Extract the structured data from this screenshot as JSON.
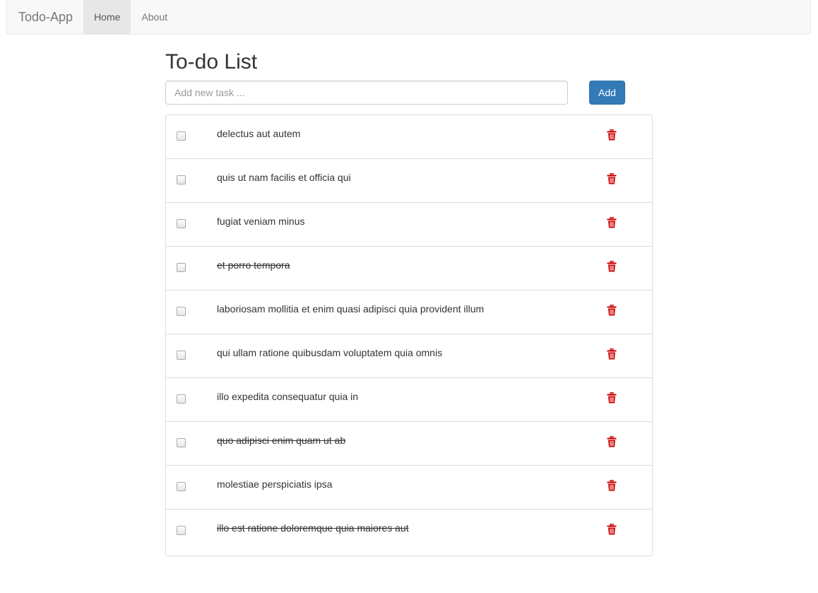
{
  "navbar": {
    "brand": "Todo-App",
    "links": [
      {
        "label": "Home",
        "active": true
      },
      {
        "label": "About",
        "active": false
      }
    ]
  },
  "main": {
    "title": "To-do List",
    "input_value": "",
    "input_placeholder": "Add new task ...",
    "add_label": "Add"
  },
  "tasks": [
    {
      "text": "delectus aut autem",
      "done": false
    },
    {
      "text": "quis ut nam facilis et officia qui",
      "done": false
    },
    {
      "text": "fugiat veniam minus",
      "done": false
    },
    {
      "text": "et porro tempora",
      "done": true
    },
    {
      "text": "laboriosam mollitia et enim quasi adipisci quia provident illum",
      "done": false
    },
    {
      "text": "qui ullam ratione quibusdam voluptatem quia omnis",
      "done": false
    },
    {
      "text": "illo expedita consequatur quia in",
      "done": false
    },
    {
      "text": "quo adipisci enim quam ut ab",
      "done": true
    },
    {
      "text": "molestiae perspiciatis ipsa",
      "done": false
    },
    {
      "text": "illo est ratione doloremque quia maiores aut",
      "done": true
    }
  ],
  "icons": {
    "delete": "trash-icon",
    "delete_color": "#cc0000"
  },
  "colors": {
    "primary": "#337ab7",
    "navbar_bg": "#f8f8f8"
  }
}
